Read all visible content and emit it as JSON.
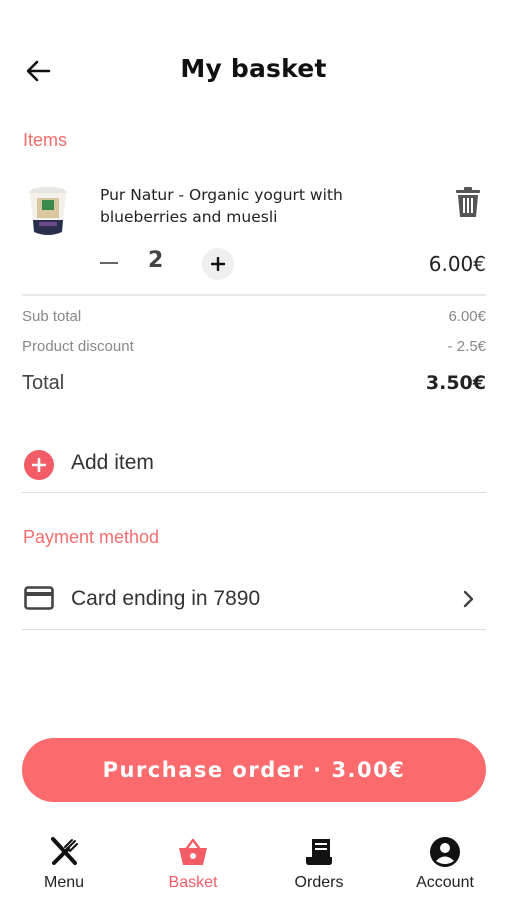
{
  "header": {
    "title": "My basket"
  },
  "items_section": {
    "label": "Items"
  },
  "item": {
    "name": "Pur Natur - Organic yogurt with blueberries and muesli",
    "quantity": "2",
    "price": "6.00€",
    "icons": {
      "delete": "trash-icon",
      "minus": "minus-icon",
      "plus": "plus-icon"
    }
  },
  "summary": {
    "subtotal_label": "Sub total",
    "subtotal_value": "6.00€",
    "discount_label": "Product discount",
    "discount_value": "- 2.5€",
    "total_label": "Total",
    "total_value": "3.50€"
  },
  "add_item": {
    "label": "Add item",
    "icon": "plus-circle-icon"
  },
  "payment": {
    "label": "Payment method",
    "card_label": "Card ending in 7890",
    "icon": "credit-card-icon"
  },
  "purchase_button": {
    "label": "Purchase order · 3.00€"
  },
  "nav": {
    "items": [
      {
        "label": "Menu",
        "icon": "fork-knife-icon",
        "active": false
      },
      {
        "label": "Basket",
        "icon": "basket-icon",
        "active": true
      },
      {
        "label": "Orders",
        "icon": "receipt-icon",
        "active": false
      },
      {
        "label": "Account",
        "icon": "account-icon",
        "active": false
      }
    ]
  },
  "colors": {
    "accent": "#f25c67",
    "section_label": "#f26d6d",
    "button": "#fb6b6e"
  }
}
